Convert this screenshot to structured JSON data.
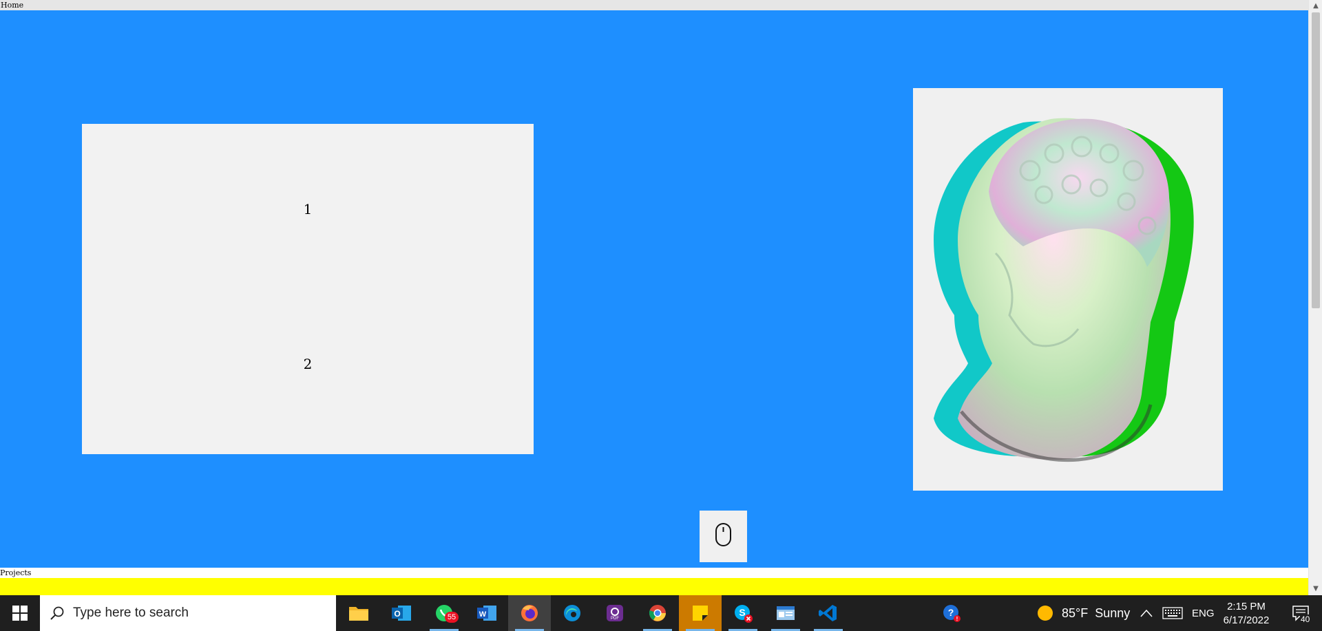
{
  "nav": {
    "home_label": "Home"
  },
  "hero": {
    "card": {
      "items": [
        "1",
        "2"
      ]
    },
    "image": {
      "alt": "Glitch-colored classical bust sculpture"
    },
    "scroll_hint_icon": "mouse-icon"
  },
  "projects": {
    "label": "Projects"
  },
  "scrollbar": {
    "up": "▲",
    "down": "▼"
  },
  "taskbar": {
    "search_placeholder": "Type here to search",
    "apps": [
      {
        "name": "file-explorer",
        "icon": "folder-icon"
      },
      {
        "name": "outlook",
        "icon": "outlook-icon"
      },
      {
        "name": "whatsapp",
        "icon": "whatsapp-icon",
        "badge": "55"
      },
      {
        "name": "word",
        "icon": "word-icon"
      },
      {
        "name": "firefox",
        "icon": "firefox-icon",
        "active": true
      },
      {
        "name": "edge",
        "icon": "edge-icon"
      },
      {
        "name": "pdf",
        "icon": "pdf-icon"
      },
      {
        "name": "chrome",
        "icon": "chrome-icon"
      },
      {
        "name": "sticky-notes",
        "icon": "sticky-notes-icon"
      },
      {
        "name": "skype",
        "icon": "skype-icon"
      },
      {
        "name": "control-panel",
        "icon": "control-panel-icon"
      },
      {
        "name": "vscode",
        "icon": "vscode-icon"
      }
    ],
    "help_icon": "help-icon",
    "weather": {
      "temp": "85°F",
      "condition": "Sunny"
    },
    "language": "ENG",
    "time": "2:15 PM",
    "date": "6/17/2022",
    "notifications": "40"
  },
  "colors": {
    "hero_bg": "#1e8fff",
    "card_bg": "#f2f2f2",
    "projects_band": "#ffff00",
    "taskbar_bg": "#1f1f1f"
  }
}
